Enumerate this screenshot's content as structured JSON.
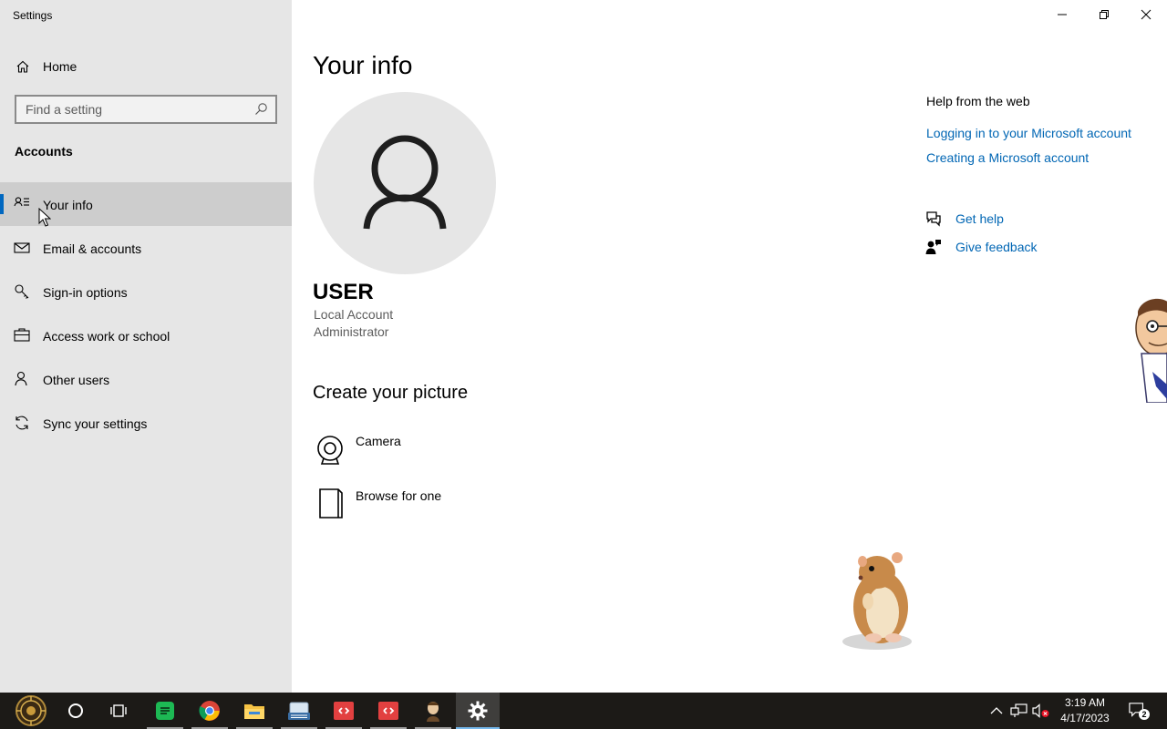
{
  "window": {
    "title": "Settings"
  },
  "sidebar": {
    "home_label": "Home",
    "search_placeholder": "Find a setting",
    "section_title": "Accounts",
    "items": [
      {
        "label": "Your info",
        "icon": "person-list-icon",
        "active": true
      },
      {
        "label": "Email & accounts",
        "icon": "mail-icon",
        "active": false
      },
      {
        "label": "Sign-in options",
        "icon": "key-icon",
        "active": false
      },
      {
        "label": "Access work or school",
        "icon": "briefcase-icon",
        "active": false
      },
      {
        "label": "Other users",
        "icon": "person-icon",
        "active": false
      },
      {
        "label": "Sync your settings",
        "icon": "sync-icon",
        "active": false
      }
    ]
  },
  "main": {
    "page_title": "Your info",
    "user": {
      "name": "USER",
      "account_type": "Local Account",
      "role": "Administrator"
    },
    "create_picture": {
      "title": "Create your picture",
      "options": [
        {
          "label": "Camera",
          "icon": "webcam-icon"
        },
        {
          "label": "Browse for one",
          "icon": "document-icon"
        }
      ]
    }
  },
  "help": {
    "title": "Help from the web",
    "links": [
      "Logging in to your Microsoft account",
      "Creating a Microsoft account"
    ],
    "get_help": "Get help",
    "give_feedback": "Give feedback"
  },
  "taskbar": {
    "time": "3:19 AM",
    "date": "4/17/2023",
    "notification_count": "2"
  },
  "colors": {
    "accent": "#0067c0",
    "link": "#0066b4",
    "sidebar_bg": "#e6e6e6",
    "taskbar_bg": "#1c1a17"
  }
}
